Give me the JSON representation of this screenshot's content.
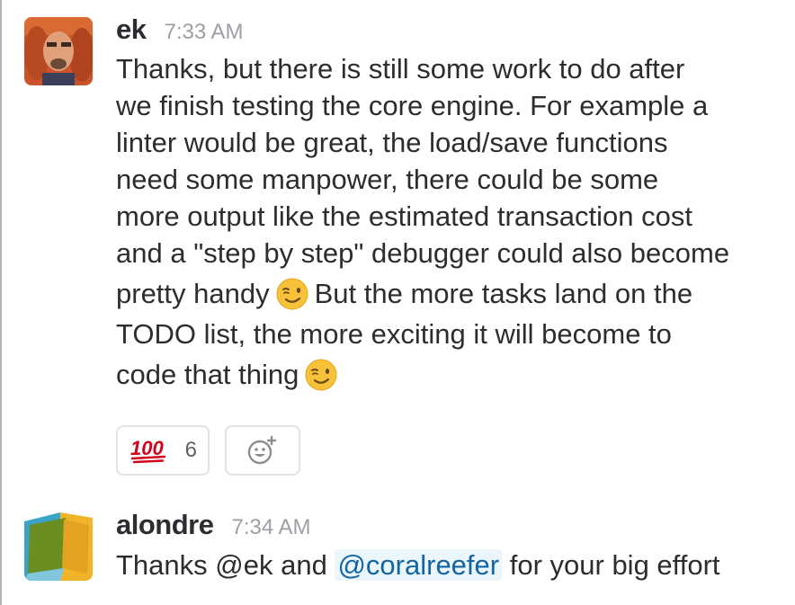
{
  "messages": [
    {
      "author": "ek",
      "timestamp": "7:33 AM",
      "lines": [
        "Thanks, but there is still some work to do after",
        "we finish testing the core engine. For example a",
        "linter would be great, the load/save functions",
        "need some manpower, there could be some",
        "more output like the estimated transaction cost",
        "and a \"step by step\" debugger could also become"
      ],
      "line7_before": "pretty handy",
      "line7_after": "But the more tasks land on the",
      "line8": "TODO list, the more exciting it will become to",
      "line9_before": "code that thing",
      "emoji": "wink-emoji",
      "reactions": [
        {
          "emoji": "100-emoji",
          "label": "💯",
          "count": "6"
        }
      ],
      "add_reaction_icon": "add-reaction-icon"
    },
    {
      "author": "alondre",
      "timestamp": "7:34 AM",
      "text_before": "Thanks @ek and",
      "mention": "@coralreefer",
      "text_after": "for your big effort"
    }
  ],
  "colors": {
    "mention_bg": "#eaf5fc",
    "mention_text": "#1264a3",
    "timestamp": "#9e9ea6",
    "text": "#2c2d30"
  }
}
